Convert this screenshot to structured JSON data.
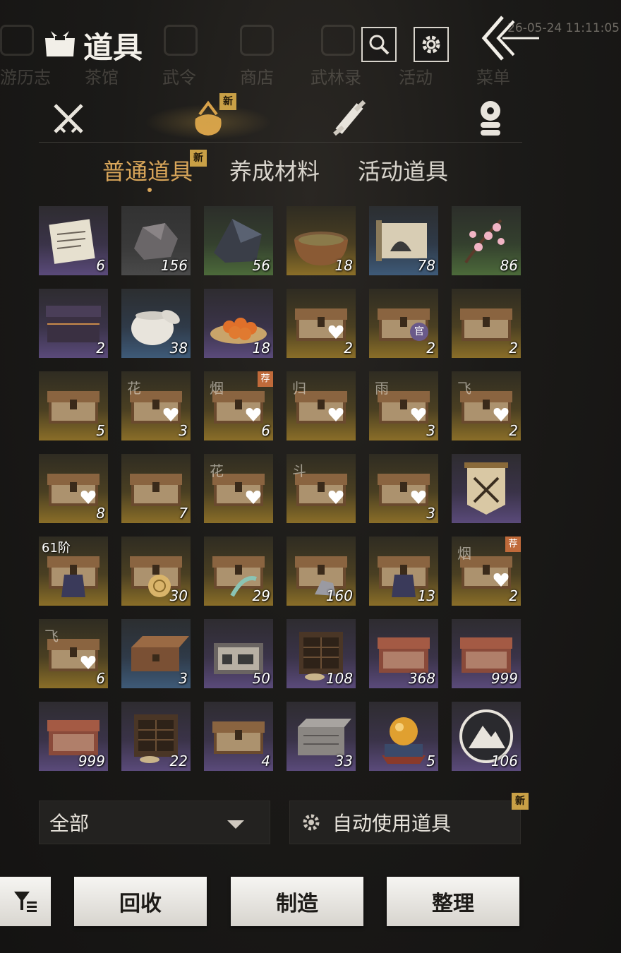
{
  "header": {
    "title": "道具",
    "timestamp": "26-05-24 11:11:05",
    "search_icon": "search-icon",
    "settings_icon": "gear-icon",
    "back_icon": "double-chevron-left-icon"
  },
  "background_nav": [
    "游历志",
    "茶馆",
    "武令",
    "商店",
    "武林录",
    "活动",
    "菜单"
  ],
  "category_tabs": [
    {
      "icon": "crossed-swords-icon",
      "active": false
    },
    {
      "icon": "bundle-bag-icon",
      "active": true,
      "badge": "新"
    },
    {
      "icon": "scroll-icon",
      "active": false
    },
    {
      "icon": "coin-stack-icon",
      "active": false
    }
  ],
  "sub_tabs": [
    {
      "label": "普通道具",
      "active": true,
      "badge": "新"
    },
    {
      "label": "养成材料",
      "active": false
    },
    {
      "label": "活动道具",
      "active": false
    }
  ],
  "items": [
    {
      "icon": "paper-document-icon",
      "qty": "6",
      "rarity": "purple"
    },
    {
      "icon": "ore-rock-icon",
      "qty": "156",
      "rarity": "gray"
    },
    {
      "icon": "dark-crystal-ore-icon",
      "qty": "56",
      "rarity": "green"
    },
    {
      "icon": "stew-pot-icon",
      "qty": "18",
      "rarity": "gold"
    },
    {
      "icon": "painting-scroll-icon",
      "qty": "78",
      "rarity": "blue"
    },
    {
      "icon": "plum-blossom-icon",
      "qty": "86",
      "rarity": "green"
    },
    {
      "icon": "ornate-chest-icon",
      "qty": "2",
      "rarity": "purple"
    },
    {
      "icon": "porcelain-jar-icon",
      "qty": "38",
      "rarity": "blue"
    },
    {
      "icon": "persimmon-plate-icon",
      "qty": "18",
      "rarity": "purple"
    },
    {
      "icon": "treasure-chest-icon",
      "qty": "2",
      "rarity": "gold",
      "heart": true
    },
    {
      "icon": "treasure-chest-icon",
      "qty": "2",
      "rarity": "gold",
      "official": "官"
    },
    {
      "icon": "treasure-chest-icon",
      "qty": "2",
      "rarity": "gold"
    },
    {
      "icon": "treasure-chest-icon",
      "qty": "5",
      "rarity": "gold"
    },
    {
      "icon": "treasure-chest-icon",
      "qty": "3",
      "rarity": "gold",
      "heart": true,
      "tag": "花"
    },
    {
      "icon": "treasure-chest-icon",
      "qty": "6",
      "rarity": "gold",
      "heart": true,
      "tag": "烟",
      "rec": "荐"
    },
    {
      "icon": "treasure-chest-icon",
      "qty": "",
      "rarity": "gold",
      "heart": true,
      "tag": "归"
    },
    {
      "icon": "treasure-chest-icon",
      "qty": "3",
      "rarity": "gold",
      "heart": true,
      "tag": "雨"
    },
    {
      "icon": "treasure-chest-icon",
      "qty": "2",
      "rarity": "gold",
      "heart": true,
      "tag": "飞"
    },
    {
      "icon": "treasure-chest-icon",
      "qty": "8",
      "rarity": "gold",
      "heart": true
    },
    {
      "icon": "treasure-chest-icon",
      "qty": "7",
      "rarity": "gold"
    },
    {
      "icon": "treasure-chest-icon",
      "qty": "",
      "rarity": "gold",
      "heart": true,
      "tag": "花"
    },
    {
      "icon": "treasure-chest-icon",
      "qty": "",
      "rarity": "gold",
      "heart": true,
      "tag": "斗"
    },
    {
      "icon": "treasure-chest-icon",
      "qty": "3",
      "rarity": "gold",
      "heart": true
    },
    {
      "icon": "crossed-swords-banner-icon",
      "qty": "",
      "rarity": "purple"
    },
    {
      "icon": "armor-chest-icon",
      "qty": "",
      "rarity": "gold",
      "tier": "61阶"
    },
    {
      "icon": "shell-chest-icon",
      "qty": "30",
      "rarity": "gold"
    },
    {
      "icon": "feather-chest-icon",
      "qty": "29",
      "rarity": "gold"
    },
    {
      "icon": "ore-chest-icon",
      "qty": "160",
      "rarity": "gold"
    },
    {
      "icon": "armor-chest-icon",
      "qty": "13",
      "rarity": "gold"
    },
    {
      "icon": "treasure-chest-icon",
      "qty": "2",
      "rarity": "gold",
      "heart": true,
      "tag": "烟",
      "rec": "荐"
    },
    {
      "icon": "treasure-chest-icon",
      "qty": "6",
      "rarity": "gold",
      "heart": true,
      "tag": "飞"
    },
    {
      "icon": "wooden-box-icon",
      "qty": "3",
      "rarity": "blue"
    },
    {
      "icon": "tool-case-icon",
      "qty": "50",
      "rarity": "purple"
    },
    {
      "icon": "cabinet-chest-icon",
      "qty": "108",
      "rarity": "purple"
    },
    {
      "icon": "carved-red-chest-icon",
      "qty": "368",
      "rarity": "purple"
    },
    {
      "icon": "carved-red-chest-icon",
      "qty": "999",
      "rarity": "purple"
    },
    {
      "icon": "carved-red-chest-icon",
      "qty": "999",
      "rarity": "purple"
    },
    {
      "icon": "cabinet-chest-icon",
      "qty": "22",
      "rarity": "purple"
    },
    {
      "icon": "treasure-chest-icon",
      "qty": "4",
      "rarity": "purple"
    },
    {
      "icon": "stone-box-icon",
      "qty": "33",
      "rarity": "purple"
    },
    {
      "icon": "golden-orb-icon",
      "qty": "5",
      "rarity": "purple"
    },
    {
      "icon": "mountain-token-icon",
      "qty": "106",
      "rarity": "purple"
    }
  ],
  "controls": {
    "filter_dropdown": "全部",
    "auto_use_label": "自动使用道具",
    "auto_use_badge": "新",
    "filter_icon": "filter-list-icon",
    "recycle_label": "回收",
    "craft_label": "制造",
    "sort_label": "整理"
  },
  "colors": {
    "accent_gold": "#d9a65a",
    "badge_gold": "#c9a046",
    "rarity_purple": "#5a4a7a",
    "rarity_gold": "#8a6e28",
    "rarity_blue": "#3e5a78",
    "rarity_green": "#4c6a3a"
  }
}
